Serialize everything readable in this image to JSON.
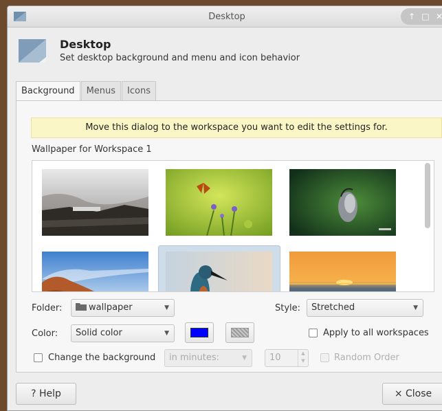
{
  "window": {
    "title": "Desktop",
    "controls": {
      "up": "↑",
      "maximize": "□",
      "close": "✕"
    }
  },
  "header": {
    "title": "Desktop",
    "subtitle": "Set desktop background and menu and icon behavior"
  },
  "tabs": [
    {
      "label": "Background",
      "active": true
    },
    {
      "label": "Menus",
      "active": false
    },
    {
      "label": "Icons",
      "active": false
    }
  ],
  "background": {
    "notice": "Move this dialog to the workspace you want to edit the settings for.",
    "wallpaper_label": "Wallpaper for Workspace 1",
    "thumbnails": [
      {
        "name": "misty-shore"
      },
      {
        "name": "butterfly-on-flowers"
      },
      {
        "name": "beetle-on-leaf"
      },
      {
        "name": "autumn-trees-sky"
      },
      {
        "name": "kingfisher",
        "selected": true
      },
      {
        "name": "ocean-sunset"
      }
    ],
    "folder_label": "Folder:",
    "folder_value": "wallpaper",
    "style_label": "Style:",
    "style_value": "Stretched",
    "color_label": "Color:",
    "color_value": "Solid color",
    "primary_color": "#0000ff",
    "apply_all_label": "Apply to all workspaces",
    "change_bg_label": "Change the background",
    "interval_value": "in minutes:",
    "interval_number": "10",
    "random_order_label": "Random Order"
  },
  "footer": {
    "help_label": "? Help",
    "close_label": "× Close"
  }
}
